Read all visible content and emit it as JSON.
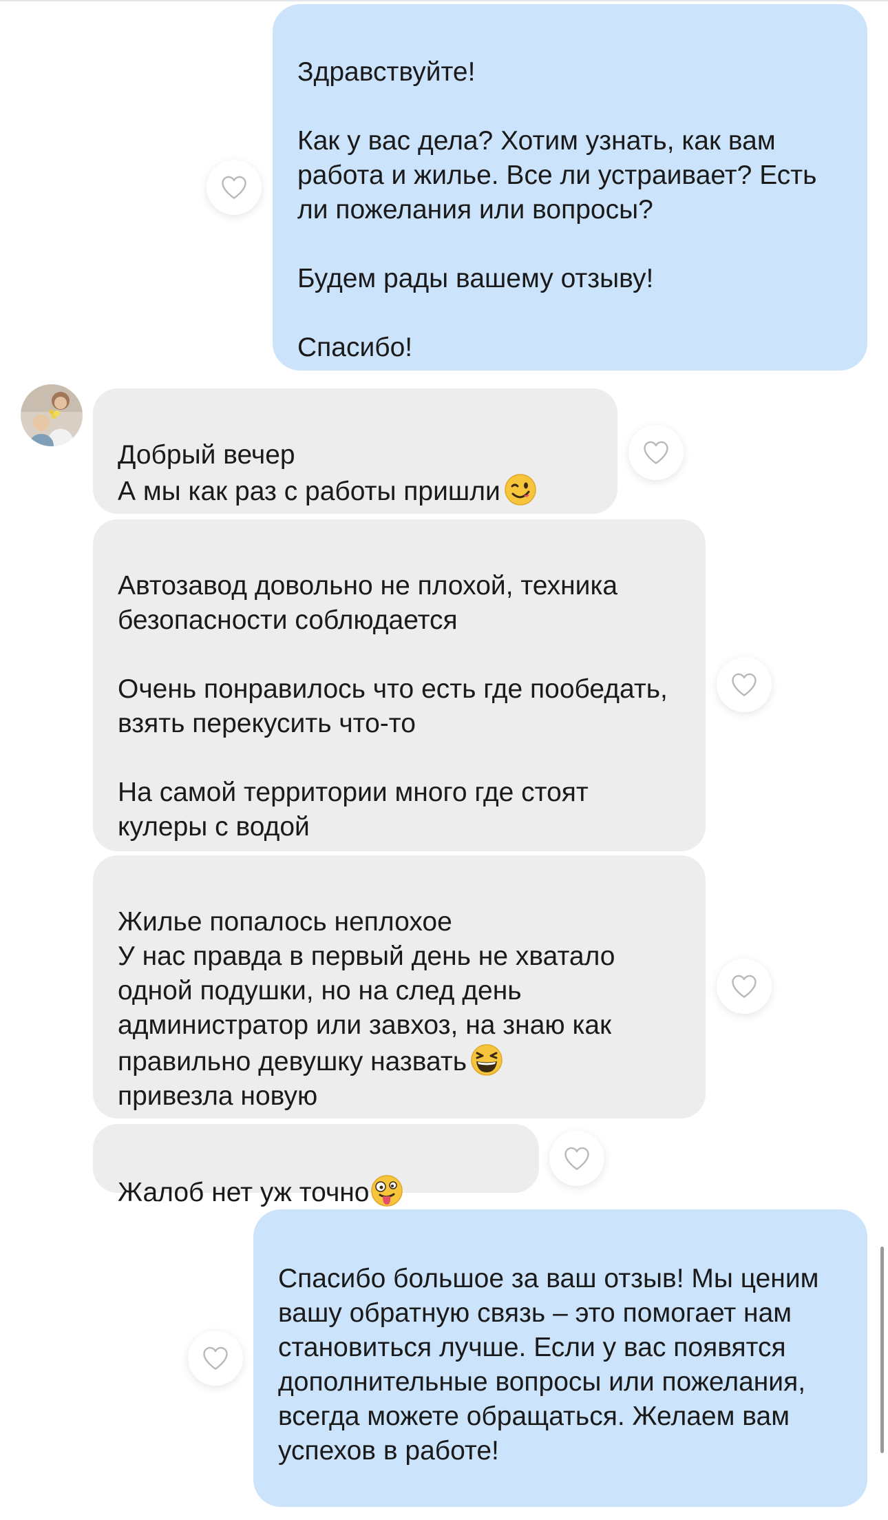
{
  "messages": [
    {
      "id": "m1",
      "direction": "outgoing",
      "text": "Здравствуйте!\n\nКак у вас дела? Хотим узнать, как вам работа и жилье. Все ли устраивает? Есть ли пожелания или вопросы?\n\nБудем рады вашему отзыву!\n\nСпасибо!"
    },
    {
      "id": "m2",
      "direction": "incoming",
      "text": "Добрый вечер\nА мы как раз с работы пришли",
      "emoji": "winking-face-emoji"
    },
    {
      "id": "m3",
      "direction": "incoming",
      "text": "Автозавод довольно не плохой, техника безопасности соблюдается\n\nОчень понравилось что есть где пообедать, взять перекусить что-то\n\nНа самой территории много где стоят кулеры с водой"
    },
    {
      "id": "m4",
      "direction": "incoming",
      "text_before": "Жилье попалось неплохое\nУ нас правда в первый день не хватало одной подушки, но на след день администратор или завхоз, на знаю как правильно  девушку назвать",
      "emoji": "grinning-squinting-face-emoji",
      "text_after": "\nпривезла новую"
    },
    {
      "id": "m5",
      "direction": "incoming",
      "text": "Жалоб нет уж точно",
      "emoji": "zany-face-emoji"
    },
    {
      "id": "m6",
      "direction": "outgoing",
      "text": "Спасибо большое за ваш отзыв! Мы ценим вашу обратную связь – это помогает нам становиться лучше. Если у вас появятся дополнительные вопросы или пожелания, всегда можете обращаться. Желаем вам успехов в работе!"
    }
  ],
  "icons": {
    "like": "heart-outline-icon",
    "avatar": "contact-avatar"
  },
  "colors": {
    "outgoing_bubble": "#cce3fc",
    "incoming_bubble": "#ededed",
    "heart_stroke": "#b8b8b8"
  }
}
